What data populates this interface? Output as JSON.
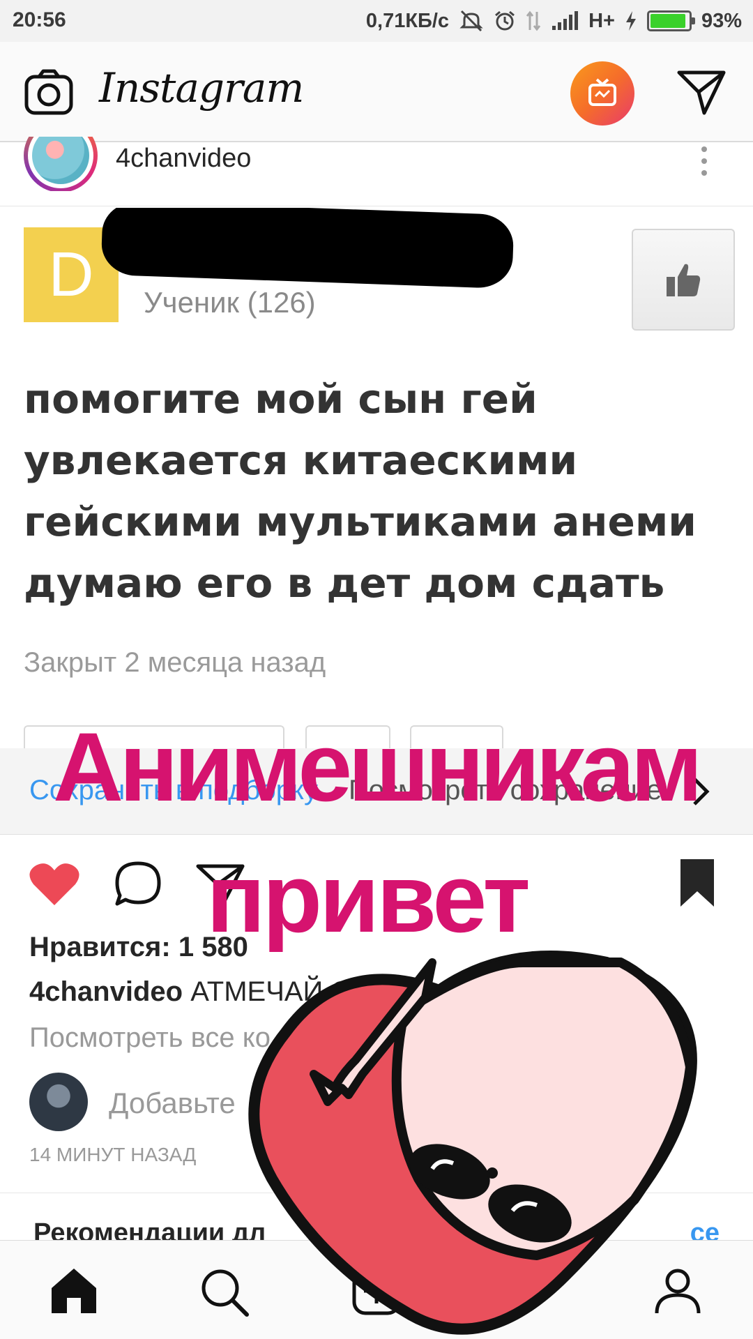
{
  "status_bar": {
    "time": "20:56",
    "net_speed": "0,71КБ/с",
    "network": "H+",
    "battery_percent": "93%",
    "battery_level": 0.93
  },
  "header": {
    "logo": "Instagram",
    "icons": [
      "camera-icon",
      "igtv-icon",
      "direct-message-icon"
    ]
  },
  "post": {
    "username": "4chanvideo",
    "image": {
      "avatar_letter": "D",
      "rank": "Ученик (126)",
      "question": "помогите мой сын гей увлекается китаескими гейскими мультиками анеми думаю его в дет дом сдать",
      "closed": "Закрыт 2 месяца назад"
    },
    "save_strip": {
      "save_label": "Сохранить в подборку",
      "view_label": "Посмотреть сохранение"
    },
    "likes": "Нравится: 1 580",
    "caption_user": "4chanvideo",
    "caption_text": "АТМЕЧАЙ ОН",
    "view_comments": "Посмотреть все ко",
    "add_comment": "Добавьте",
    "timestamp": "14 МИНУТ НАЗАД"
  },
  "recommendations": {
    "title": "Рекомендации дл",
    "see_all": "се"
  },
  "overlay": {
    "line1": "Анимешникам",
    "line2": "привет"
  },
  "colors": {
    "overlay_text": "#d6136f",
    "like_red": "#ed4956",
    "link_blue": "#3897f0"
  }
}
